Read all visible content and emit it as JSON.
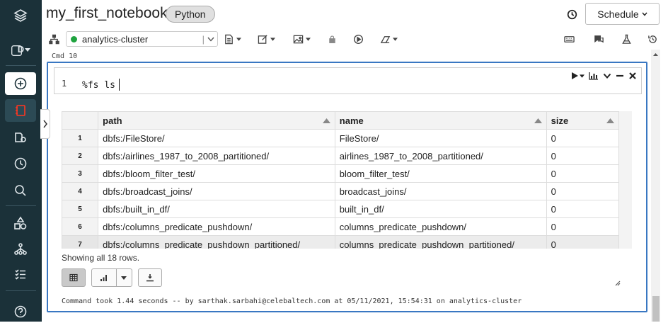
{
  "sidebar": {
    "items": [
      {
        "name": "layers-icon"
      },
      {
        "name": "workspace-switcher",
        "label": "D"
      },
      {
        "name": "create-icon"
      },
      {
        "name": "notebook-icon"
      },
      {
        "name": "data-icon"
      },
      {
        "name": "recents-icon"
      },
      {
        "name": "search-icon"
      },
      {
        "name": "shapes-icon"
      },
      {
        "name": "workflows-icon"
      },
      {
        "name": "list-icon"
      },
      {
        "name": "help-icon"
      }
    ]
  },
  "header": {
    "title": "my_first_notebook",
    "language": "Python",
    "schedule_label": "Schedule"
  },
  "toolbar": {
    "cluster_name": "analytics-cluster",
    "cluster_status_color": "#1fa33f",
    "cluster_dropdown_sep": "|"
  },
  "cell": {
    "cmd_label": "Cmd 10",
    "line_number": "1",
    "code": "%fs ls",
    "results": {
      "columns": [
        "path",
        "name",
        "size"
      ],
      "rows": [
        {
          "n": "1",
          "path": "dbfs:/FileStore/",
          "name": "FileStore/",
          "size": "0"
        },
        {
          "n": "2",
          "path": "dbfs:/airlines_1987_to_2008_partitioned/",
          "name": "airlines_1987_to_2008_partitioned/",
          "size": "0"
        },
        {
          "n": "3",
          "path": "dbfs:/bloom_filter_test/",
          "name": "bloom_filter_test/",
          "size": "0"
        },
        {
          "n": "4",
          "path": "dbfs:/broadcast_joins/",
          "name": "broadcast_joins/",
          "size": "0"
        },
        {
          "n": "5",
          "path": "dbfs:/built_in_df/",
          "name": "built_in_df/",
          "size": "0"
        },
        {
          "n": "6",
          "path": "dbfs:/columns_predicate_pushdown/",
          "name": "columns_predicate_pushdown/",
          "size": "0"
        },
        {
          "n": "7",
          "path": "dbfs:/columns_predicate_pushdown_partitioned/",
          "name": "columns_predicate_pushdown_partitioned/",
          "size": "0"
        }
      ]
    },
    "showing_text": "Showing all 18 rows.",
    "command_took": "Command took 1.44 seconds -- by sarthak.sarbahi@celebaltech.com at 05/11/2021, 15:54:31 on analytics-cluster"
  },
  "colors": {
    "sidebar_bg": "#1b3139",
    "active_accent": "#ff3621",
    "cell_border": "#3977c2"
  }
}
